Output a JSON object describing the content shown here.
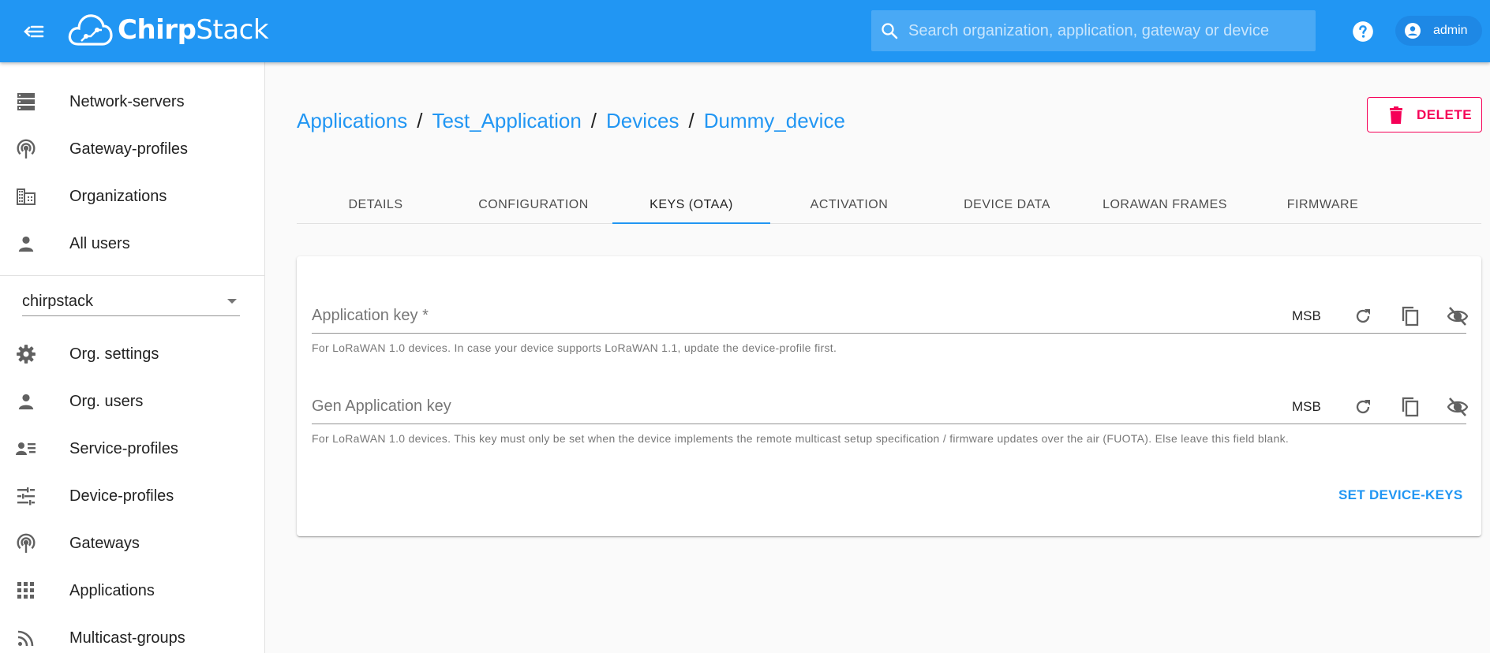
{
  "header": {
    "brand_part1": "Chirp",
    "brand_part2": "Stack",
    "search_placeholder": "Search organization, application, gateway or device",
    "user_label": "admin",
    "color_primary": "#2196f3"
  },
  "sidebar": {
    "global_items": [
      {
        "label": "Network-servers",
        "icon": "server-icon"
      },
      {
        "label": "Gateway-profiles",
        "icon": "wifi-tethering-icon"
      },
      {
        "label": "Organizations",
        "icon": "domain-icon"
      },
      {
        "label": "All users",
        "icon": "person-icon"
      }
    ],
    "org_select_value": "chirpstack",
    "org_items": [
      {
        "label": "Org. settings",
        "icon": "gear-icon"
      },
      {
        "label": "Org. users",
        "icon": "person-icon"
      },
      {
        "label": "Service-profiles",
        "icon": "account-details-icon"
      },
      {
        "label": "Device-profiles",
        "icon": "tune-icon"
      },
      {
        "label": "Gateways",
        "icon": "wifi-tethering-icon"
      },
      {
        "label": "Applications",
        "icon": "apps-icon"
      },
      {
        "label": "Multicast-groups",
        "icon": "rss-icon"
      }
    ]
  },
  "breadcrumb": {
    "items": [
      "Applications",
      "Test_Application",
      "Devices",
      "Dummy_device"
    ],
    "separator": "/"
  },
  "delete_label": "DELETE",
  "tabs": {
    "items": [
      "DETAILS",
      "CONFIGURATION",
      "KEYS (OTAA)",
      "ACTIVATION",
      "DEVICE DATA",
      "LORAWAN FRAMES",
      "FIRMWARE"
    ],
    "active": "KEYS (OTAA)"
  },
  "keys_form": {
    "app_key": {
      "label": "Application key *",
      "byte_order": "MSB",
      "helper": "For LoRaWAN 1.0 devices. In case your device supports LoRaWAN 1.1, update the device-profile first."
    },
    "gen_app_key": {
      "label": "Gen Application key",
      "byte_order": "MSB",
      "helper": "For LoRaWAN 1.0 devices. This key must only be set when the device implements the remote multicast setup specification / firmware updates over the air (FUOTA). Else leave this field blank."
    },
    "submit_label": "SET DEVICE-KEYS"
  }
}
